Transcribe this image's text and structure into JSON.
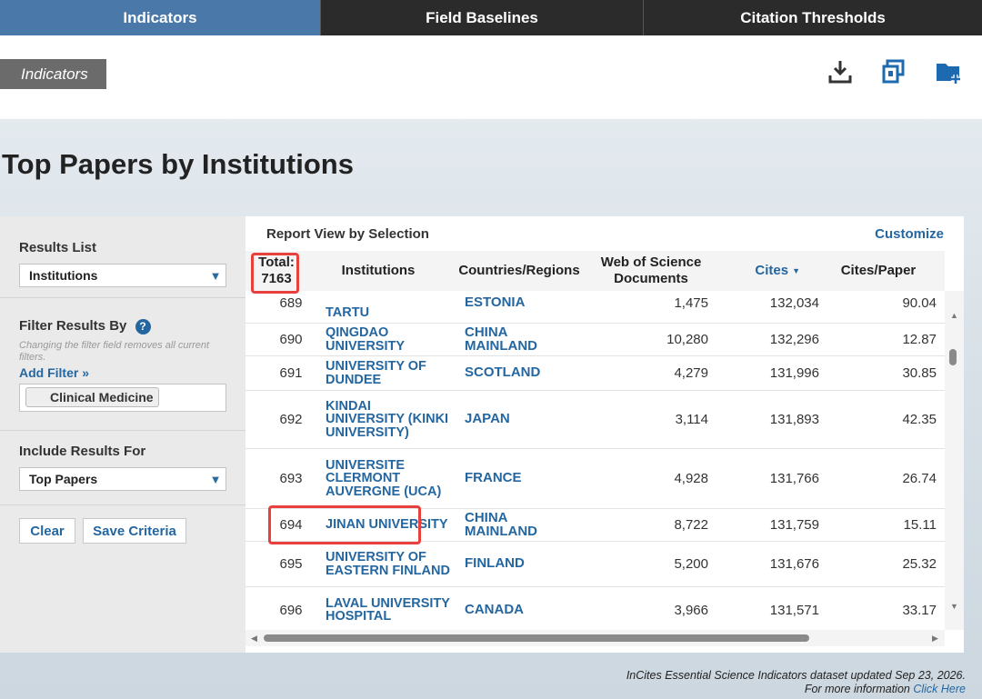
{
  "tabs": [
    {
      "label": "Indicators"
    },
    {
      "label": "Field Baselines"
    },
    {
      "label": "Citation Thresholds"
    }
  ],
  "breadcrumb": "Indicators",
  "header_icons": [
    "download-icon",
    "print-icon",
    "add-folder-icon"
  ],
  "page_title": "Top Papers by Institutions",
  "sidebar": {
    "results_list_label": "Results List",
    "results_list_value": "Institutions",
    "filter_label": "Filter Results By",
    "filter_note": "Changing the filter field removes all current filters.",
    "add_filter": "Add Filter »",
    "filter_chip": "Clinical Medicine",
    "include_label": "Include Results For",
    "include_value": "Top Papers",
    "clear": "Clear",
    "save_criteria": "Save Criteria"
  },
  "report": {
    "title": "Report View by Selection",
    "customize": "Customize",
    "columns": {
      "total": "Total: 7163",
      "institutions": "Institutions",
      "countries": "Countries/Regions",
      "docs": "Web of Science Documents",
      "cites": "Cites",
      "cites_per_paper": "Cites/Paper"
    },
    "rows": [
      {
        "rank": "689",
        "institution": "TARTU",
        "country": "ESTONIA",
        "docs": "1,475",
        "cites": "132,034",
        "cpp": "90.04"
      },
      {
        "rank": "690",
        "institution": "QINGDAO UNIVERSITY",
        "country": "CHINA MAINLAND",
        "docs": "10,280",
        "cites": "132,296",
        "cpp": "12.87"
      },
      {
        "rank": "691",
        "institution": "UNIVERSITY OF DUNDEE",
        "country": "SCOTLAND",
        "docs": "4,279",
        "cites": "131,996",
        "cpp": "30.85"
      },
      {
        "rank": "692",
        "institution": "KINDAI UNIVERSITY (KINKI UNIVERSITY)",
        "country": "JAPAN",
        "docs": "3,114",
        "cites": "131,893",
        "cpp": "42.35"
      },
      {
        "rank": "693",
        "institution": "UNIVERSITE CLERMONT AUVERGNE (UCA)",
        "country": "FRANCE",
        "docs": "4,928",
        "cites": "131,766",
        "cpp": "26.74"
      },
      {
        "rank": "694",
        "institution": "JINAN UNIVERSITY",
        "country": "CHINA MAINLAND",
        "docs": "8,722",
        "cites": "131,759",
        "cpp": "15.11"
      },
      {
        "rank": "695",
        "institution": "UNIVERSITY OF EASTERN FINLAND",
        "country": "FINLAND",
        "docs": "5,200",
        "cites": "131,676",
        "cpp": "25.32"
      },
      {
        "rank": "696",
        "institution": "LAVAL UNIVERSITY HOSPITAL",
        "country": "CANADA",
        "docs": "3,966",
        "cites": "131,571",
        "cpp": "33.17"
      }
    ]
  },
  "footer": {
    "line1": "InCites Essential Science Indicators dataset updated Sep 23, 2026.",
    "line2_prefix": "For more information",
    "line2_link": "Click Here"
  },
  "colors": {
    "accent": "#2466a0",
    "active_tab": "#4a79a9",
    "highlight": "#e8413d"
  }
}
